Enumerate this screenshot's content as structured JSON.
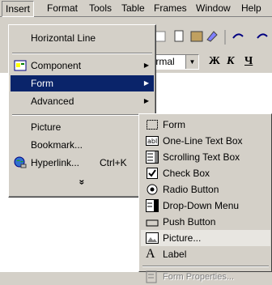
{
  "menubar": [
    {
      "label": "Insert",
      "active": true
    },
    {
      "label": "Format"
    },
    {
      "label": "Tools"
    },
    {
      "label": "Table"
    },
    {
      "label": "Frames"
    },
    {
      "label": "Window"
    },
    {
      "label": "Help"
    }
  ],
  "toolbar": {
    "style_combo": "Normal",
    "bold": "Ж",
    "italic": "К",
    "underline": "Ч"
  },
  "insert_menu": {
    "horizontal_line": "Horizontal Line",
    "component": "Component",
    "form": "Form",
    "advanced": "Advanced",
    "picture": "Picture",
    "bookmark": "Bookmark...",
    "hyperlink": "Hyperlink...",
    "hyperlink_shortcut": "Ctrl+K",
    "more": "»"
  },
  "form_submenu": {
    "form": "Form",
    "one_line_text_box": "One-Line Text Box",
    "scrolling_text_box": "Scrolling Text Box",
    "check_box": "Check Box",
    "radio_button": "Radio Button",
    "drop_down_menu": "Drop-Down Menu",
    "push_button": "Push Button",
    "picture": "Picture...",
    "label": "Label",
    "form_properties": "Form Properties..."
  },
  "colors": {
    "highlight": "#0a246a",
    "face": "#d4d0c8"
  }
}
